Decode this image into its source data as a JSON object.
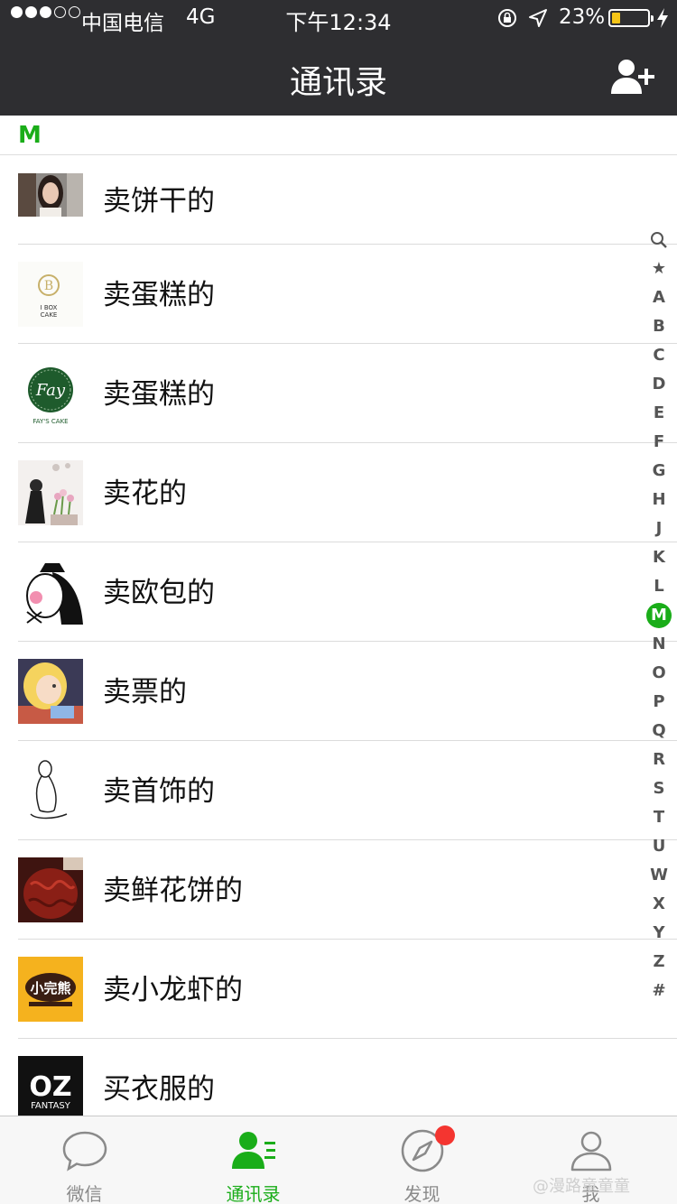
{
  "status_bar": {
    "carrier": "中国电信",
    "network": "4G",
    "time": "下午12:34",
    "battery_percent": "23%",
    "battery_level": 0.23,
    "signal_bars_filled": 3,
    "signal_bars_total": 5
  },
  "nav": {
    "title": "通讯录",
    "add_icon": "add-contact-icon"
  },
  "section": {
    "letter": "M"
  },
  "contacts": [
    {
      "name": "卖饼干的",
      "avatar": "portrait-woman-avatar"
    },
    {
      "name": "卖蛋糕的",
      "avatar": "box-cake-logo-avatar"
    },
    {
      "name": "卖蛋糕的",
      "avatar": "fays-cake-logo-avatar"
    },
    {
      "name": "卖花的",
      "avatar": "girl-with-flowers-avatar"
    },
    {
      "name": "卖欧包的",
      "avatar": "cartoon-face-avatar"
    },
    {
      "name": "卖票的",
      "avatar": "alice-cartoon-avatar"
    },
    {
      "name": "卖首饰的",
      "avatar": "sketch-figure-avatar"
    },
    {
      "name": "卖鲜花饼的",
      "avatar": "red-carving-avatar"
    },
    {
      "name": "卖小龙虾的",
      "avatar": "crayfish-logo-avatar"
    },
    {
      "name": "买衣服的",
      "avatar": "oz-fantasy-logo-avatar"
    }
  ],
  "avatar_text": {
    "box_cake_1": "I BOX",
    "box_cake_2": "CAKE",
    "fay_logo": "Fay",
    "fay_caption": "FAY'S CAKE",
    "crayfish_logo": "小完熊",
    "oz": "OZ",
    "oz_sub": "FANTASY"
  },
  "index_bar": {
    "items": [
      "★",
      "A",
      "B",
      "C",
      "D",
      "E",
      "F",
      "G",
      "H",
      "J",
      "K",
      "L",
      "M",
      "N",
      "O",
      "P",
      "Q",
      "R",
      "S",
      "T",
      "U",
      "W",
      "X",
      "Y",
      "Z",
      "#"
    ],
    "active": "M",
    "search_icon": "search-icon"
  },
  "tabs": [
    {
      "label": "微信",
      "icon": "chat-bubble-icon",
      "active": false
    },
    {
      "label": "通讯录",
      "icon": "contacts-icon",
      "active": true
    },
    {
      "label": "发现",
      "icon": "compass-icon",
      "active": false,
      "badge": true
    },
    {
      "label": "我",
      "icon": "person-icon",
      "active": false
    }
  ],
  "watermark": "@漫路童童童",
  "colors": {
    "accent": "#1aad19",
    "navbar": "#2e2e31",
    "badge": "#f43530",
    "battery": "#f5c518"
  }
}
